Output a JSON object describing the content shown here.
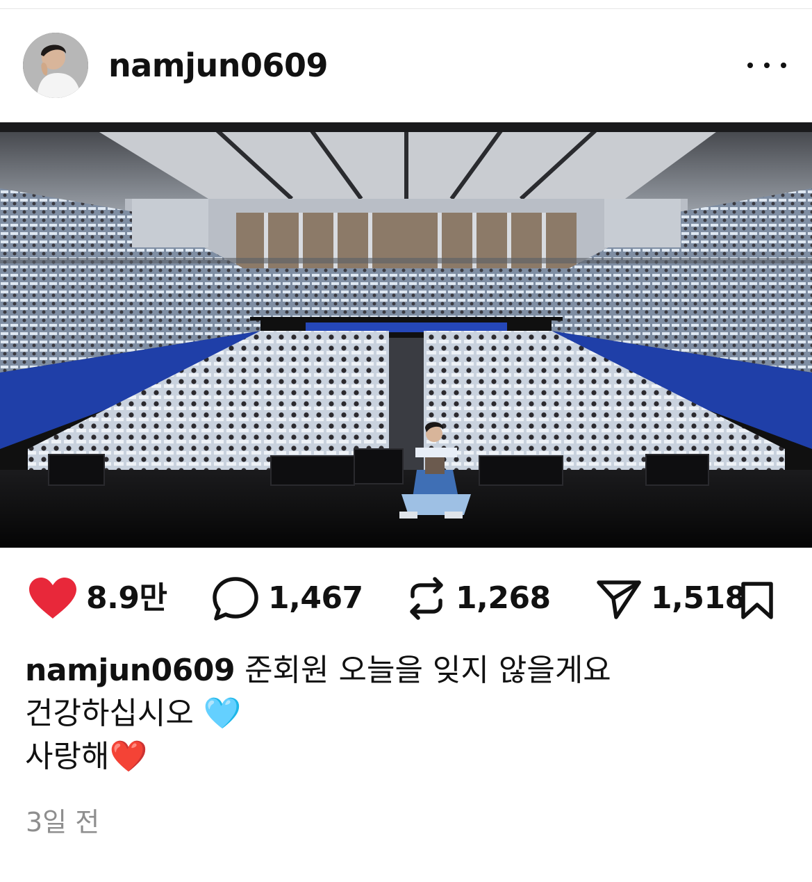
{
  "post": {
    "username": "namjun0609",
    "stats": {
      "likes": "8.9만",
      "comments": "1,467",
      "reposts": "1,268",
      "shares": "1,518"
    },
    "caption": {
      "line1": "준회원 오늘을 잊지 않을게요",
      "line2": "건강하십시오 🩵",
      "line3": "사랑해❤️"
    },
    "timestamp": "3일 전"
  },
  "colors": {
    "like_heart": "#e8283a",
    "text": "#111111",
    "muted": "#8e8e8e"
  },
  "icons": {
    "more": "more-icon",
    "like": "heart-icon",
    "comment": "comment-icon",
    "repost": "repost-icon",
    "share": "share-icon",
    "save": "bookmark-icon"
  }
}
